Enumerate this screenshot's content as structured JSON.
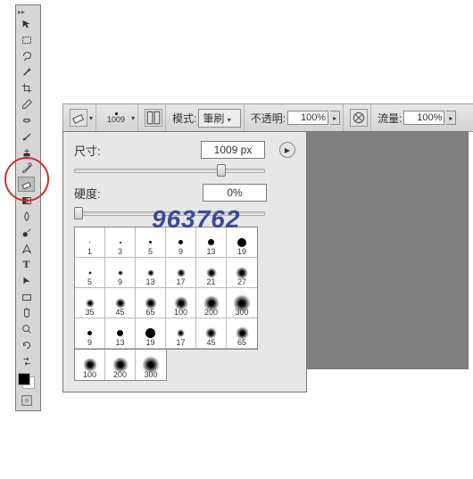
{
  "toolbar": {
    "tools": [
      "move",
      "rect-marquee",
      "lasso",
      "magic-wand",
      "crop",
      "eyedropper",
      "spot-heal",
      "brush",
      "clone-stamp",
      "history-brush",
      "eraser",
      "gradient",
      "blur",
      "dodge",
      "pen",
      "type",
      "path-select",
      "rectangle",
      "hand",
      "zoom",
      "rotate-view",
      "switch"
    ],
    "selected_index": 10
  },
  "options_bar": {
    "tool_icon": "eraser",
    "brush_preview_size": "1009",
    "mode_label": "模式:",
    "mode_value": "筆刷",
    "opacity_label": "不透明:",
    "opacity_value": "100%",
    "flow_label": "流量:",
    "flow_value": "100%"
  },
  "brush_panel": {
    "size_label": "尺寸:",
    "size_value": "1009 px",
    "hardness_label": "硬度:",
    "hardness_value": "0%",
    "grid": [
      {
        "n": "1",
        "d": 1,
        "soft": false
      },
      {
        "n": "3",
        "d": 2,
        "soft": false
      },
      {
        "n": "5",
        "d": 3,
        "soft": false
      },
      {
        "n": "9",
        "d": 5,
        "soft": false
      },
      {
        "n": "13",
        "d": 7,
        "soft": false
      },
      {
        "n": "19",
        "d": 10,
        "soft": false
      },
      {
        "n": "5",
        "d": 4,
        "soft": true
      },
      {
        "n": "9",
        "d": 6,
        "soft": true
      },
      {
        "n": "13",
        "d": 8,
        "soft": true
      },
      {
        "n": "17",
        "d": 10,
        "soft": true
      },
      {
        "n": "21",
        "d": 12,
        "soft": true
      },
      {
        "n": "27",
        "d": 14,
        "soft": true
      },
      {
        "n": "35",
        "d": 10,
        "soft": true
      },
      {
        "n": "45",
        "d": 12,
        "soft": true
      },
      {
        "n": "65",
        "d": 14,
        "soft": true
      },
      {
        "n": "100",
        "d": 16,
        "soft": true
      },
      {
        "n": "200",
        "d": 18,
        "soft": true
      },
      {
        "n": "300",
        "d": 20,
        "soft": true
      },
      {
        "n": "9",
        "d": 5,
        "soft": false
      },
      {
        "n": "13",
        "d": 7,
        "soft": false
      },
      {
        "n": "19",
        "d": 11,
        "soft": false
      },
      {
        "n": "17",
        "d": 9,
        "soft": true
      },
      {
        "n": "45",
        "d": 13,
        "soft": true
      },
      {
        "n": "65",
        "d": 15,
        "soft": true
      }
    ],
    "bottom": [
      {
        "n": "100",
        "d": 16,
        "soft": true
      },
      {
        "n": "200",
        "d": 18,
        "soft": true
      },
      {
        "n": "300",
        "d": 20,
        "soft": true
      }
    ]
  },
  "watermark": "963762"
}
